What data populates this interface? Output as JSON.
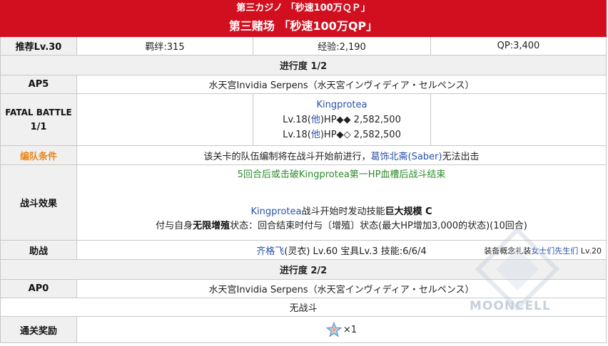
{
  "header": {
    "line1": "第三カジノ 「秒速100万ＱＰ」",
    "line2": "第三赌场 「秒速100万QP」"
  },
  "info": {
    "level": "推荐Lv.30",
    "bond": "羁绊:315",
    "exp": "经验:2,190",
    "qp": "QP:3,400"
  },
  "phase1": {
    "progress": "进行度 1/2",
    "ap_label": "AP5",
    "location": "水天宫Invidia Serpens（水天宮インヴィディア・セルペンス）",
    "fatal_label_1": "FATAL BATTLE",
    "fatal_label_2": "1/1",
    "enemy_name": "Kingprotea",
    "enemy_line1_pre": "Lv.18(",
    "enemy_line1_class": "他",
    "enemy_line1_post": ")HP◆◆ 2,582,500",
    "enemy_line2_pre": "Lv.18(",
    "enemy_line2_class": "他",
    "enemy_line2_post": ")HP◆◇ 2,582,500",
    "party_label": "编队条件",
    "party_text_pre": "该关卡的队伍编制将在战斗开始前进行，",
    "party_servant": "葛饰北斋(Saber)",
    "party_text_post": "无法出击",
    "effect_label": "战斗效果",
    "effect_green": "5回合后或击破Kingprotea第一HP血槽后战斗结束",
    "effect_line2_name": "Kingprotea",
    "effect_line2_mid": "战斗开始时发动技能",
    "effect_line2_skill": "巨大规模 C",
    "effect_line3_pre": "付与自身",
    "effect_line3_bold": "无限增殖",
    "effect_line3_post": "状态：回合结束时付与〔增殖〕状态(最大HP增加3,000的状态)(10回合)",
    "support_label": "助战",
    "support_servant": "齐格飞",
    "support_detail": "(灵衣) Lv.60 宝具Lv.3 技能:6/6/4",
    "support_ce_pre": "装备概念礼装",
    "support_ce_name": "女士们先生们",
    "support_ce_lv": " Lv.20"
  },
  "phase2": {
    "progress": "进行度 2/2",
    "ap_label": "AP0",
    "location": "水天宫Invidia Serpens（水天宮インヴィディア・セルペンス）",
    "no_battle": "无战斗",
    "reward_label": "通关奖励",
    "reward_count": "×1",
    "reward_icon": "saint-quartz-icon"
  },
  "watermark": "MOONCELL",
  "colors": {
    "header_bg": "#d10f1f",
    "link_blue": "#2a4fa8",
    "green": "#2b8a2b",
    "orange": "#e8861a",
    "label_bg": "#f0f0f0"
  }
}
